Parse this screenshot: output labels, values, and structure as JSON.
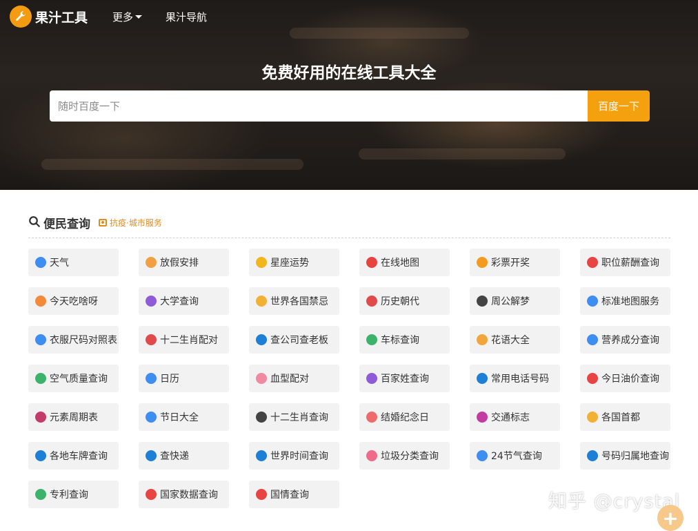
{
  "header": {
    "logo_text": "果汁工具",
    "nav": {
      "more_label": "更多",
      "guide_label": "果汁导航"
    }
  },
  "hero": {
    "title": "免费好用的在线工具大全",
    "search": {
      "placeholder": "随时百度一下",
      "value": "",
      "button_label": "百度一下"
    }
  },
  "section": {
    "title": "便民查询",
    "tag": "抗疫·城市服务"
  },
  "tools": [
    {
      "label": "天气",
      "icon": "weather-icon",
      "color": "#3d8ef0"
    },
    {
      "label": "放假安排",
      "icon": "calendar-note-icon",
      "color": "#f0a040"
    },
    {
      "label": "星座运势",
      "icon": "star-icon",
      "color": "#f3b51c"
    },
    {
      "label": "在线地图",
      "icon": "map-pin-icon",
      "color": "#e8423f"
    },
    {
      "label": "彩票开奖",
      "icon": "lottery-icon",
      "color": "#f39a1f"
    },
    {
      "label": "职位薪酬查询",
      "icon": "yen-icon",
      "color": "#e84444"
    },
    {
      "label": "今天吃啥呀",
      "icon": "food-icon",
      "color": "#f28a3a"
    },
    {
      "label": "大学查询",
      "icon": "graduation-cap-icon",
      "color": "#8e5cd9"
    },
    {
      "label": "世界各国禁忌",
      "icon": "forbidden-icon",
      "color": "#f2b035"
    },
    {
      "label": "历史朝代",
      "icon": "history-icon",
      "color": "#e04a4a"
    },
    {
      "label": "周公解梦",
      "icon": "dream-icon",
      "color": "#444444"
    },
    {
      "label": "标准地图服务",
      "icon": "globe-icon",
      "color": "#3d8ef0"
    },
    {
      "label": "衣服尺码对照表",
      "icon": "ruler-icon",
      "color": "#3d8ef0"
    },
    {
      "label": "十二生肖配对",
      "icon": "rooster-icon",
      "color": "#e04a4a"
    },
    {
      "label": "查公司查老板",
      "icon": "company-icon",
      "color": "#1e7fd6"
    },
    {
      "label": "车标查询",
      "icon": "car-badge-icon",
      "color": "#3bb36a"
    },
    {
      "label": "花语大全",
      "icon": "flower-icon",
      "color": "#f2a53a"
    },
    {
      "label": "营养成分查询",
      "icon": "pie-chart-icon",
      "color": "#3d8ef0"
    },
    {
      "label": "空气质量查询",
      "icon": "leaf-icon",
      "color": "#3bb36a"
    },
    {
      "label": "日历",
      "icon": "calendar-icon",
      "color": "#3d8ef0"
    },
    {
      "label": "血型配对",
      "icon": "blood-drop-icon",
      "color": "#f08aa0"
    },
    {
      "label": "百家姓查询",
      "icon": "surname-icon",
      "color": "#8e5cd9"
    },
    {
      "label": "常用电话号码",
      "icon": "phone-icon",
      "color": "#1e7fd6"
    },
    {
      "label": "今日油价查询",
      "icon": "fuel-pump-icon",
      "color": "#e84444"
    },
    {
      "label": "元素周期表",
      "icon": "molecule-icon",
      "color": "#c43a6a"
    },
    {
      "label": "节日大全",
      "icon": "gift-icon",
      "color": "#3d8ef0"
    },
    {
      "label": "十二生肖查询",
      "icon": "zodiac-icon",
      "color": "#444444"
    },
    {
      "label": "结婚纪念日",
      "icon": "rings-icon",
      "color": "#f06a6a"
    },
    {
      "label": "交通标志",
      "icon": "traffic-sign-icon",
      "color": "#c43aa0"
    },
    {
      "label": "各国首都",
      "icon": "capital-icon",
      "color": "#f2b035"
    },
    {
      "label": "各地车牌查询",
      "icon": "car-icon",
      "color": "#1e7fd6"
    },
    {
      "label": "查快递",
      "icon": "delivery-truck-icon",
      "color": "#1e7fd6"
    },
    {
      "label": "世界时间查询",
      "icon": "clock-icon",
      "color": "#1e7fd6"
    },
    {
      "label": "垃圾分类查询",
      "icon": "trash-bin-icon",
      "color": "#f06a8a"
    },
    {
      "label": "24节气查询",
      "icon": "solar-term-icon",
      "color": "#3d8ef0"
    },
    {
      "label": "号码归属地查询",
      "icon": "phone-location-icon",
      "color": "#1e7fd6"
    },
    {
      "label": "专利查询",
      "icon": "patent-icon",
      "color": "#3bb36a"
    },
    {
      "label": "国家数据查询",
      "icon": "china-flag-icon",
      "color": "#e84444"
    },
    {
      "label": "国情查询",
      "icon": "national-emblem-icon",
      "color": "#e84444"
    }
  ],
  "watermark": "知乎 @crystal",
  "fab_symbol": "+"
}
